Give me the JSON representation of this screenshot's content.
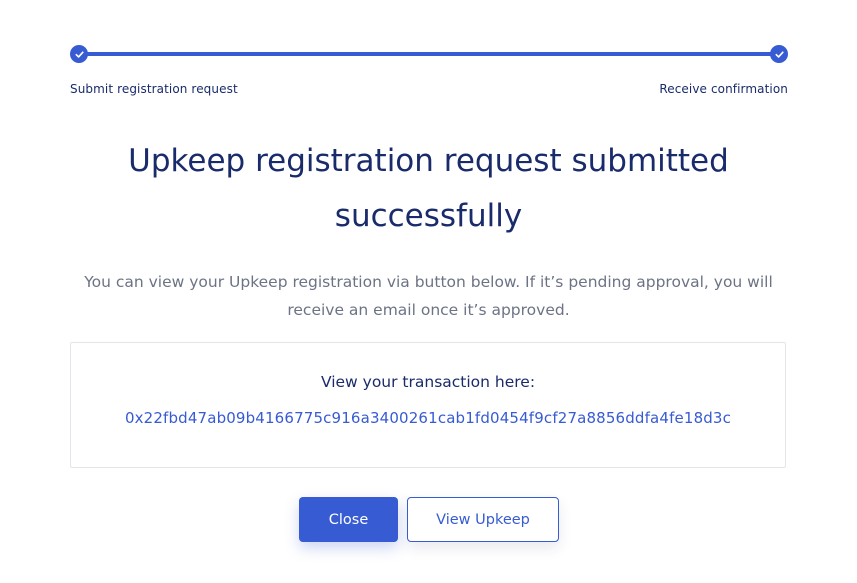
{
  "stepper": {
    "steps": [
      {
        "label": "Submit registration request",
        "status": "completed"
      },
      {
        "label": "Receive confirmation",
        "status": "completed"
      }
    ],
    "progress": 1.0
  },
  "title": {
    "line1": "Upkeep registration request submitted",
    "line2": "successfully"
  },
  "description": "You can view your Upkeep registration via button below. If it’s pending approval, you will receive an email once it’s approved.",
  "transaction": {
    "label": "View your transaction here:",
    "hash": "0x22fbd47ab09b4166775c916a3400261cab1fd0454f9cf27a8856ddfa4fe18d3c"
  },
  "buttons": {
    "close_label": "Close",
    "view_upkeep_label": "View Upkeep"
  },
  "colors": {
    "accent": "#375bd2",
    "heading": "#1a2b6b",
    "muted": "#6c7385",
    "border": "#e3e5eb"
  },
  "icons": [
    "check-icon"
  ]
}
